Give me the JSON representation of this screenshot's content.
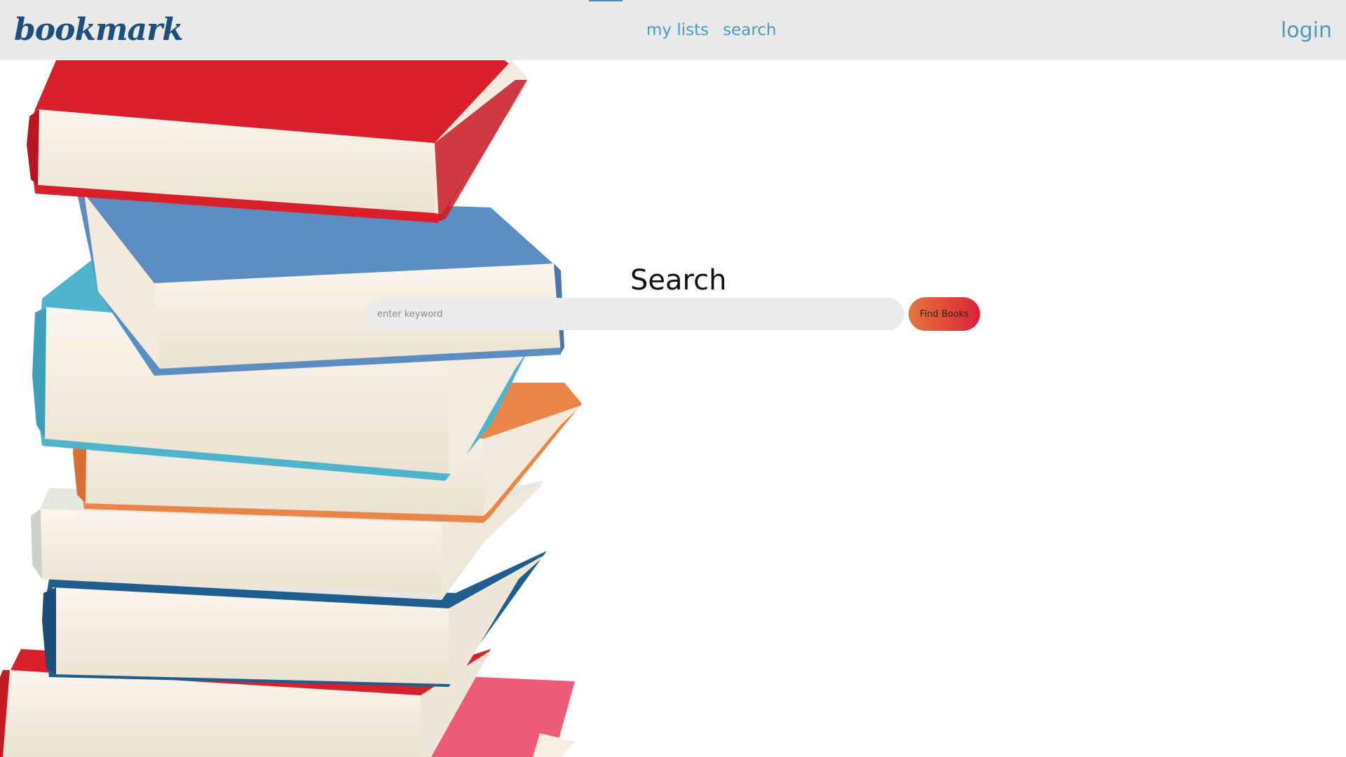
{
  "navbar": {
    "brand": "bookmark",
    "links": [
      {
        "label": "my lists"
      },
      {
        "label": "search"
      }
    ],
    "login_label": "login"
  },
  "search": {
    "title": "Search",
    "placeholder": "enter keyword",
    "value": "",
    "button_label": "Find Books"
  },
  "colors": {
    "navbar_bg": "#e9e9e9",
    "brand": "#1d4f7a",
    "link": "#4a9ab8",
    "input_bg": "#ebebeb",
    "button_gradient_start": "#e3753f",
    "button_gradient_end": "#d9203a"
  },
  "hero_image": {
    "icon": "book-stack-illustration",
    "book_colors": [
      "#d8202c",
      "#5b8cc2",
      "#4eb3cc",
      "#ea8548",
      "#dcdcdc",
      "#1f5d8e",
      "#d8202c",
      "#ef5a78"
    ]
  }
}
